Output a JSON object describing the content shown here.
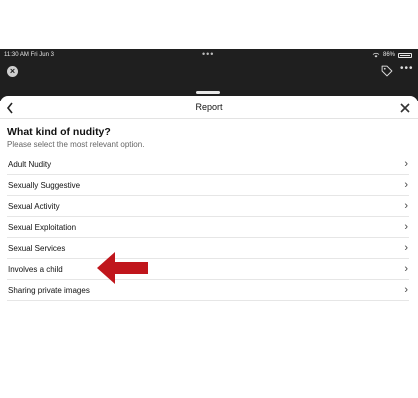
{
  "status_bar": {
    "time": "11:30 AM",
    "date": "Fri Jun 3",
    "battery": "86%",
    "center_indicator": "•••"
  },
  "viewer_toolbar": {
    "close_icon": "close-circle-icon",
    "tag_icon": "tag-icon",
    "more_label": "•••"
  },
  "sheet": {
    "title": "Report",
    "back_label": "<",
    "close_label": "✕",
    "question": "What kind of nudity?",
    "subtitle": "Please select the most relevant option.",
    "options": [
      {
        "label": "Adult Nudity"
      },
      {
        "label": "Sexually Suggestive"
      },
      {
        "label": "Sexual Activity"
      },
      {
        "label": "Sexual Exploitation"
      },
      {
        "label": "Sexual Services"
      },
      {
        "label": "Involves a child"
      },
      {
        "label": "Sharing private images"
      }
    ],
    "chevron": "›"
  },
  "annotation": {
    "arrow_color": "#c0161c",
    "points_to": "Involves a child"
  },
  "colors": {
    "dark_background": "#1f1f1f",
    "sheet_background": "#ffffff",
    "divider": "#e6e6e6"
  }
}
